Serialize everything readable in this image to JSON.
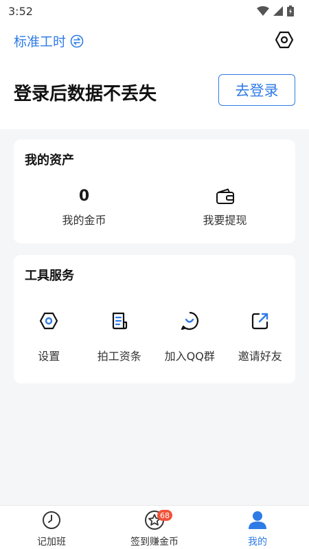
{
  "status_bar": {
    "time": "3:52"
  },
  "header": {
    "mode_label": "标准工时",
    "slogan": "登录后数据不丢失",
    "login_button": "去登录"
  },
  "assets": {
    "title": "我的资产",
    "coins_value": "0",
    "coins_label": "我的金币",
    "withdraw_label": "我要提现"
  },
  "tools": {
    "title": "工具服务",
    "items": [
      {
        "label": "设置",
        "icon": "gear-icon"
      },
      {
        "label": "拍工资条",
        "icon": "receipt-icon"
      },
      {
        "label": "加入QQ群",
        "icon": "chat-smile-icon"
      },
      {
        "label": "邀请好友",
        "icon": "share-icon"
      }
    ]
  },
  "tabbar": {
    "items": [
      {
        "label": "记加班",
        "icon": "clock-icon"
      },
      {
        "label": "签到赚金币",
        "icon": "star-coin-icon",
        "badge": "68"
      },
      {
        "label": "我的",
        "icon": "user-icon",
        "active": true
      }
    ]
  },
  "colors": {
    "accent": "#2f7be6",
    "badge": "#f0533a",
    "background": "#f5f6f8"
  }
}
